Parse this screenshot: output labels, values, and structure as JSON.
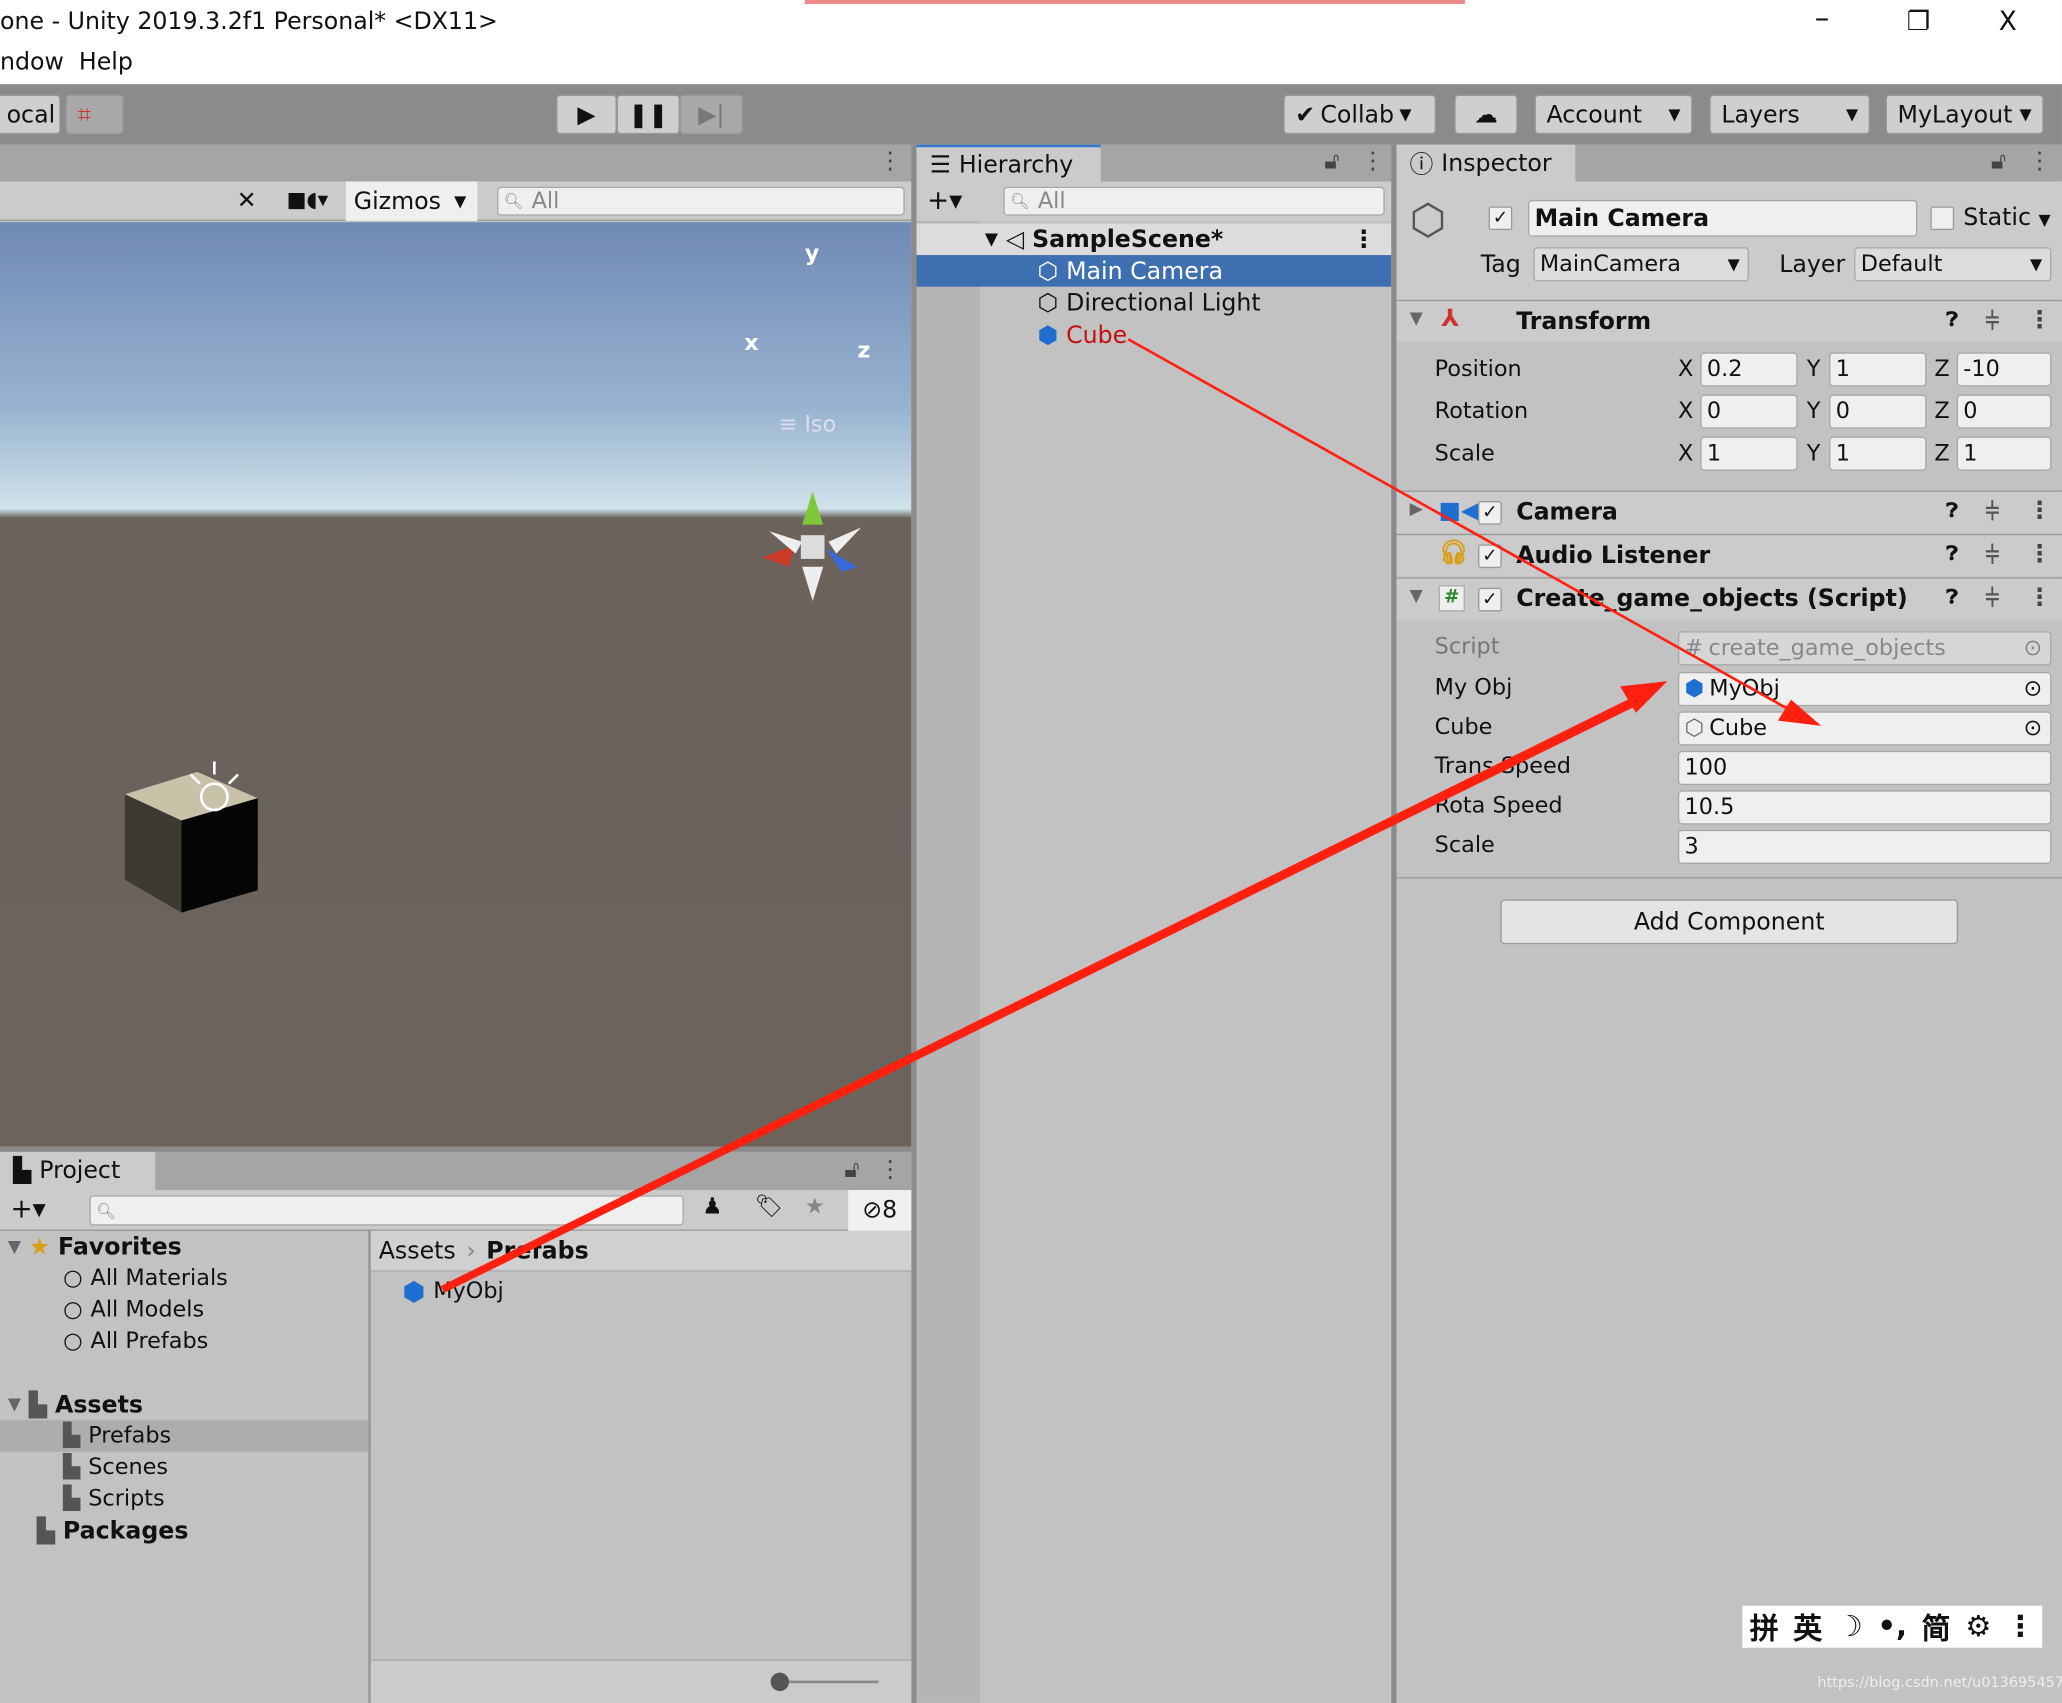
{
  "window": {
    "title": "one - Unity 2019.3.2f1 Personal* <DX11>",
    "menu": [
      "ndow",
      "Help"
    ],
    "minimize": "–",
    "restore": "❐",
    "close": "X"
  },
  "toolbar": {
    "local": "ocal",
    "collab": "Collab",
    "account": "Account",
    "layers": "Layers",
    "layout": "MyLayout"
  },
  "scene": {
    "gizmos": "Gizmos",
    "search_placeholder": "All",
    "axis_y": "y",
    "axis_x": "x",
    "axis_z": "z",
    "iso": "Iso"
  },
  "hierarchy": {
    "tab": "Hierarchy",
    "search_placeholder": "All",
    "scene": "SampleScene*",
    "items": [
      {
        "label": "Main Camera",
        "selected": true
      },
      {
        "label": "Directional Light"
      },
      {
        "label": "Cube",
        "color": "#c41010"
      }
    ]
  },
  "inspector": {
    "tab": "Inspector",
    "object_name": "Main Camera",
    "static_label": "Static",
    "tag_label": "Tag",
    "tag_value": "MainCamera",
    "layer_label": "Layer",
    "layer_value": "Default",
    "transform": {
      "title": "Transform",
      "rows": [
        {
          "label": "Position",
          "x": "0.2",
          "y": "1",
          "z": "-10"
        },
        {
          "label": "Rotation",
          "x": "0",
          "y": "0",
          "z": "0"
        },
        {
          "label": "Scale",
          "x": "1",
          "y": "1",
          "z": "1"
        }
      ]
    },
    "camera": "Camera",
    "audio": "Audio Listener",
    "script": {
      "title": "Create_game_objects (Script)",
      "script_label": "Script",
      "script_value": "create_game_objects",
      "myobj_label": "My Obj",
      "myobj_value": "MyObj",
      "cube_label": "Cube",
      "cube_value": "Cube",
      "trans_label": "Trans Speed",
      "trans_value": "100",
      "rota_label": "Rota Speed",
      "rota_value": "10.5",
      "scale_label": "Scale",
      "scale_value": "3"
    },
    "add_component": "Add Component"
  },
  "project": {
    "tab": "Project",
    "hidden_count": "8",
    "favorites": "Favorites",
    "fav_items": [
      "All Materials",
      "All Models",
      "All Prefabs"
    ],
    "assets": "Assets",
    "asset_folders": [
      "Prefabs",
      "Scenes",
      "Scripts"
    ],
    "packages": "Packages",
    "breadcrumb_root": "Assets",
    "breadcrumb_current": "Prefabs",
    "files": [
      "MyObj"
    ]
  },
  "ime": {
    "chars": [
      "拼",
      "英",
      "☽",
      "•,",
      "简",
      "⚙",
      "⋮"
    ]
  },
  "watermark": "https://blog.csdn.net/u013695457",
  "colors": {
    "selection": "#3e6fb0",
    "annotation_arrow": "#ff2010",
    "prefab_blue": "#1f6fd0"
  }
}
